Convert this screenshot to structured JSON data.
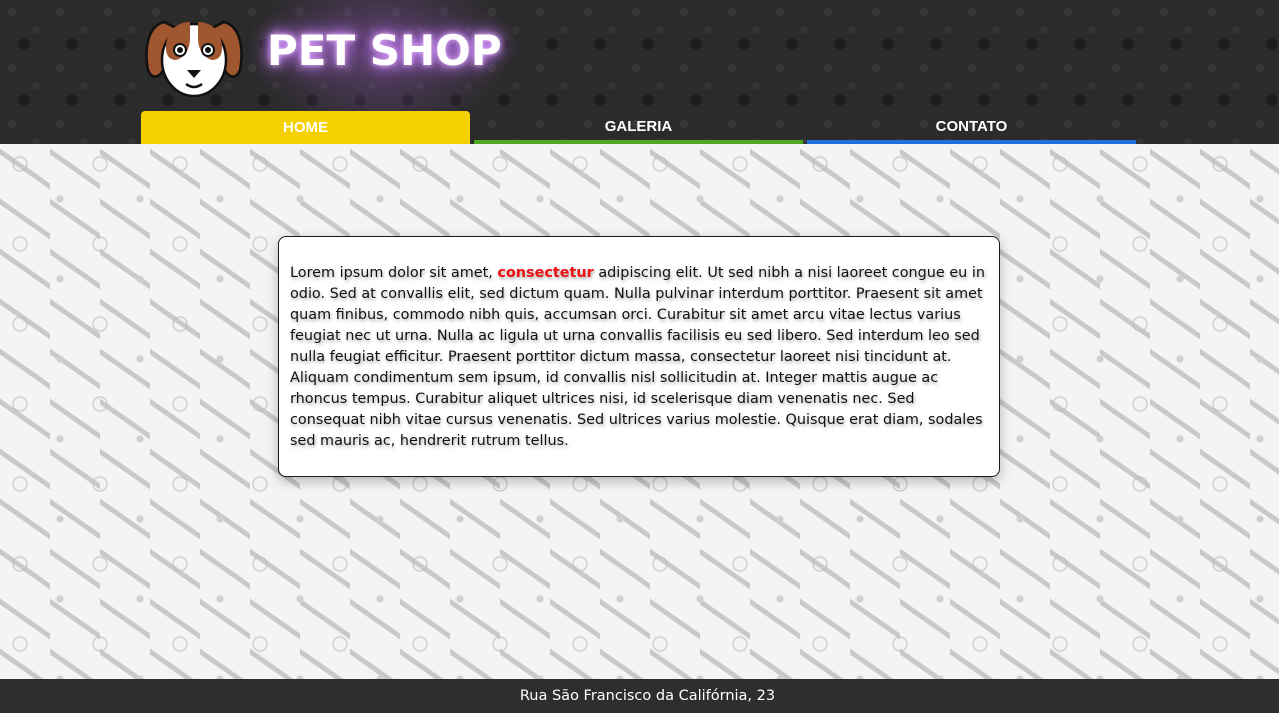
{
  "header": {
    "brand_title": "PET SHOP",
    "logo_icon": "dog-face-icon"
  },
  "nav": {
    "items": [
      {
        "label": "HOME",
        "active": true,
        "accent": "#f5d100"
      },
      {
        "label": "GALERIA",
        "active": false,
        "accent": "#4fa820"
      },
      {
        "label": "CONTATO",
        "active": false,
        "accent": "#1e6fd9"
      }
    ]
  },
  "content": {
    "text_before": "Lorem ipsum dolor sit amet, ",
    "highlight": "consectetur",
    "text_after": " adipiscing elit. Ut sed nibh a nisi laoreet congue eu in odio. Sed at convallis elit, sed dictum quam. Nulla pulvinar interdum porttitor. Praesent sit amet quam finibus, commodo nibh quis, accumsan orci. Curabitur sit amet arcu vitae lectus varius feugiat nec ut urna. Nulla ac ligula ut urna convallis facilisis eu sed libero. Sed interdum leo sed nulla feugiat efficitur. Praesent porttitor dictum massa, consectetur laoreet nisi tincidunt at. Aliquam condimentum sem ipsum, id convallis nisl sollicitudin at. Integer mattis augue ac rhoncus tempus. Curabitur aliquet ultrices nisi, id scelerisque diam venenatis nec. Sed consequat nibh vitae cursus venenatis. Sed ultrices varius molestie. Quisque erat diam, sodales sed mauris ac, hendrerit rutrum tellus."
  },
  "footer": {
    "address": "Rua São Francisco da Califórnia, 23"
  },
  "colors": {
    "header_bg": "#2b2b2b",
    "highlight": "#ee1111",
    "brand_glow": "#c77dff"
  }
}
